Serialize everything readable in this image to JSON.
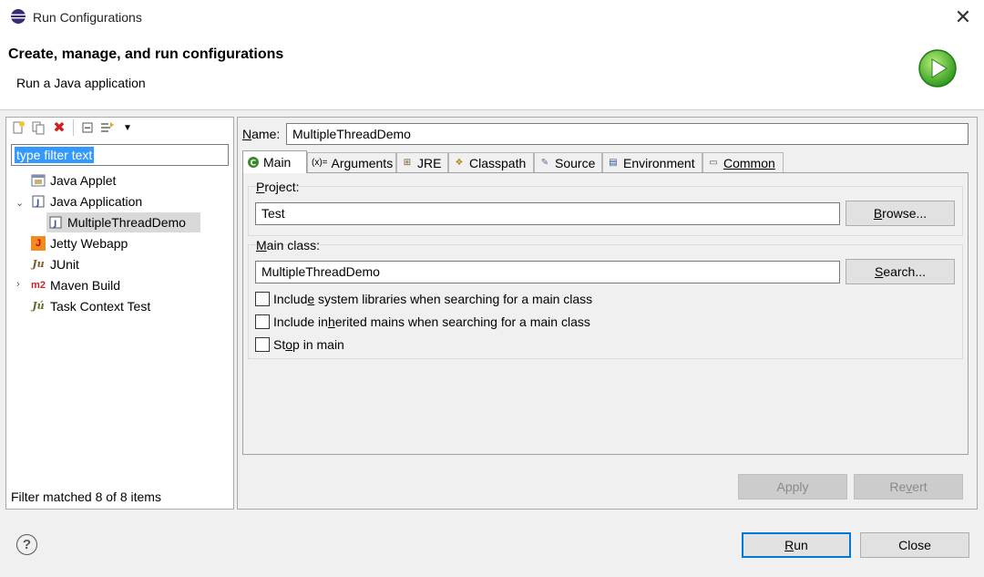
{
  "window": {
    "title": "Run Configurations",
    "close_glyph": "✕"
  },
  "header": {
    "title": "Create, manage, and run configurations",
    "subtitle": "Run a Java application"
  },
  "left": {
    "filter_placeholder": "type filter text",
    "tree": [
      {
        "label": "Java Applet",
        "icon": "java-applet-icon",
        "glyph": "▣"
      },
      {
        "label": "Java Application",
        "icon": "java-application-icon",
        "glyph": "J",
        "expanded": true
      },
      {
        "label": "MultipleThreadDemo",
        "icon": "java-class-icon",
        "glyph": "J",
        "selected": true
      },
      {
        "label": "Jetty Webapp",
        "icon": "jetty-icon",
        "glyph": "J"
      },
      {
        "label": "JUnit",
        "icon": "junit-icon",
        "glyph": "Ju"
      },
      {
        "label": "Maven Build",
        "icon": "maven-icon",
        "glyph": "m2"
      },
      {
        "label": "Task Context Test",
        "icon": "task-context-icon",
        "glyph": "Jú"
      }
    ],
    "status": "Filter matched 8 of 8 items"
  },
  "right": {
    "name_label": "Name:",
    "name_value": "MultipleThreadDemo",
    "tabs": [
      {
        "label": "Main",
        "icon": "main-tab-icon",
        "glyph": "C"
      },
      {
        "label": "Arguments",
        "icon": "arguments-tab-icon",
        "glyph": "(x)="
      },
      {
        "label": "JRE",
        "icon": "jre-tab-icon",
        "glyph": "⊞"
      },
      {
        "label": "Classpath",
        "icon": "classpath-tab-icon",
        "glyph": "❖"
      },
      {
        "label": "Source",
        "icon": "source-tab-icon",
        "glyph": "✎"
      },
      {
        "label": "Environment",
        "icon": "environment-tab-icon",
        "glyph": "▤"
      },
      {
        "label": "Common",
        "icon": "common-tab-icon",
        "glyph": "▭"
      }
    ],
    "project_label": "Project:",
    "project_value": "Test",
    "browse_label": "Browse...",
    "main_class_label": "Main class:",
    "main_class_value": "MultipleThreadDemo",
    "search_label": "Search...",
    "check_system_libs": "Include system libraries when searching for a main class",
    "check_inherited": "Include inherited mains when searching for a main class",
    "check_stop": "Stop in main",
    "apply_label": "Apply",
    "revert_label": "Revert"
  },
  "footer": {
    "help_glyph": "?",
    "run_label": "Run",
    "close_label": "Close"
  }
}
